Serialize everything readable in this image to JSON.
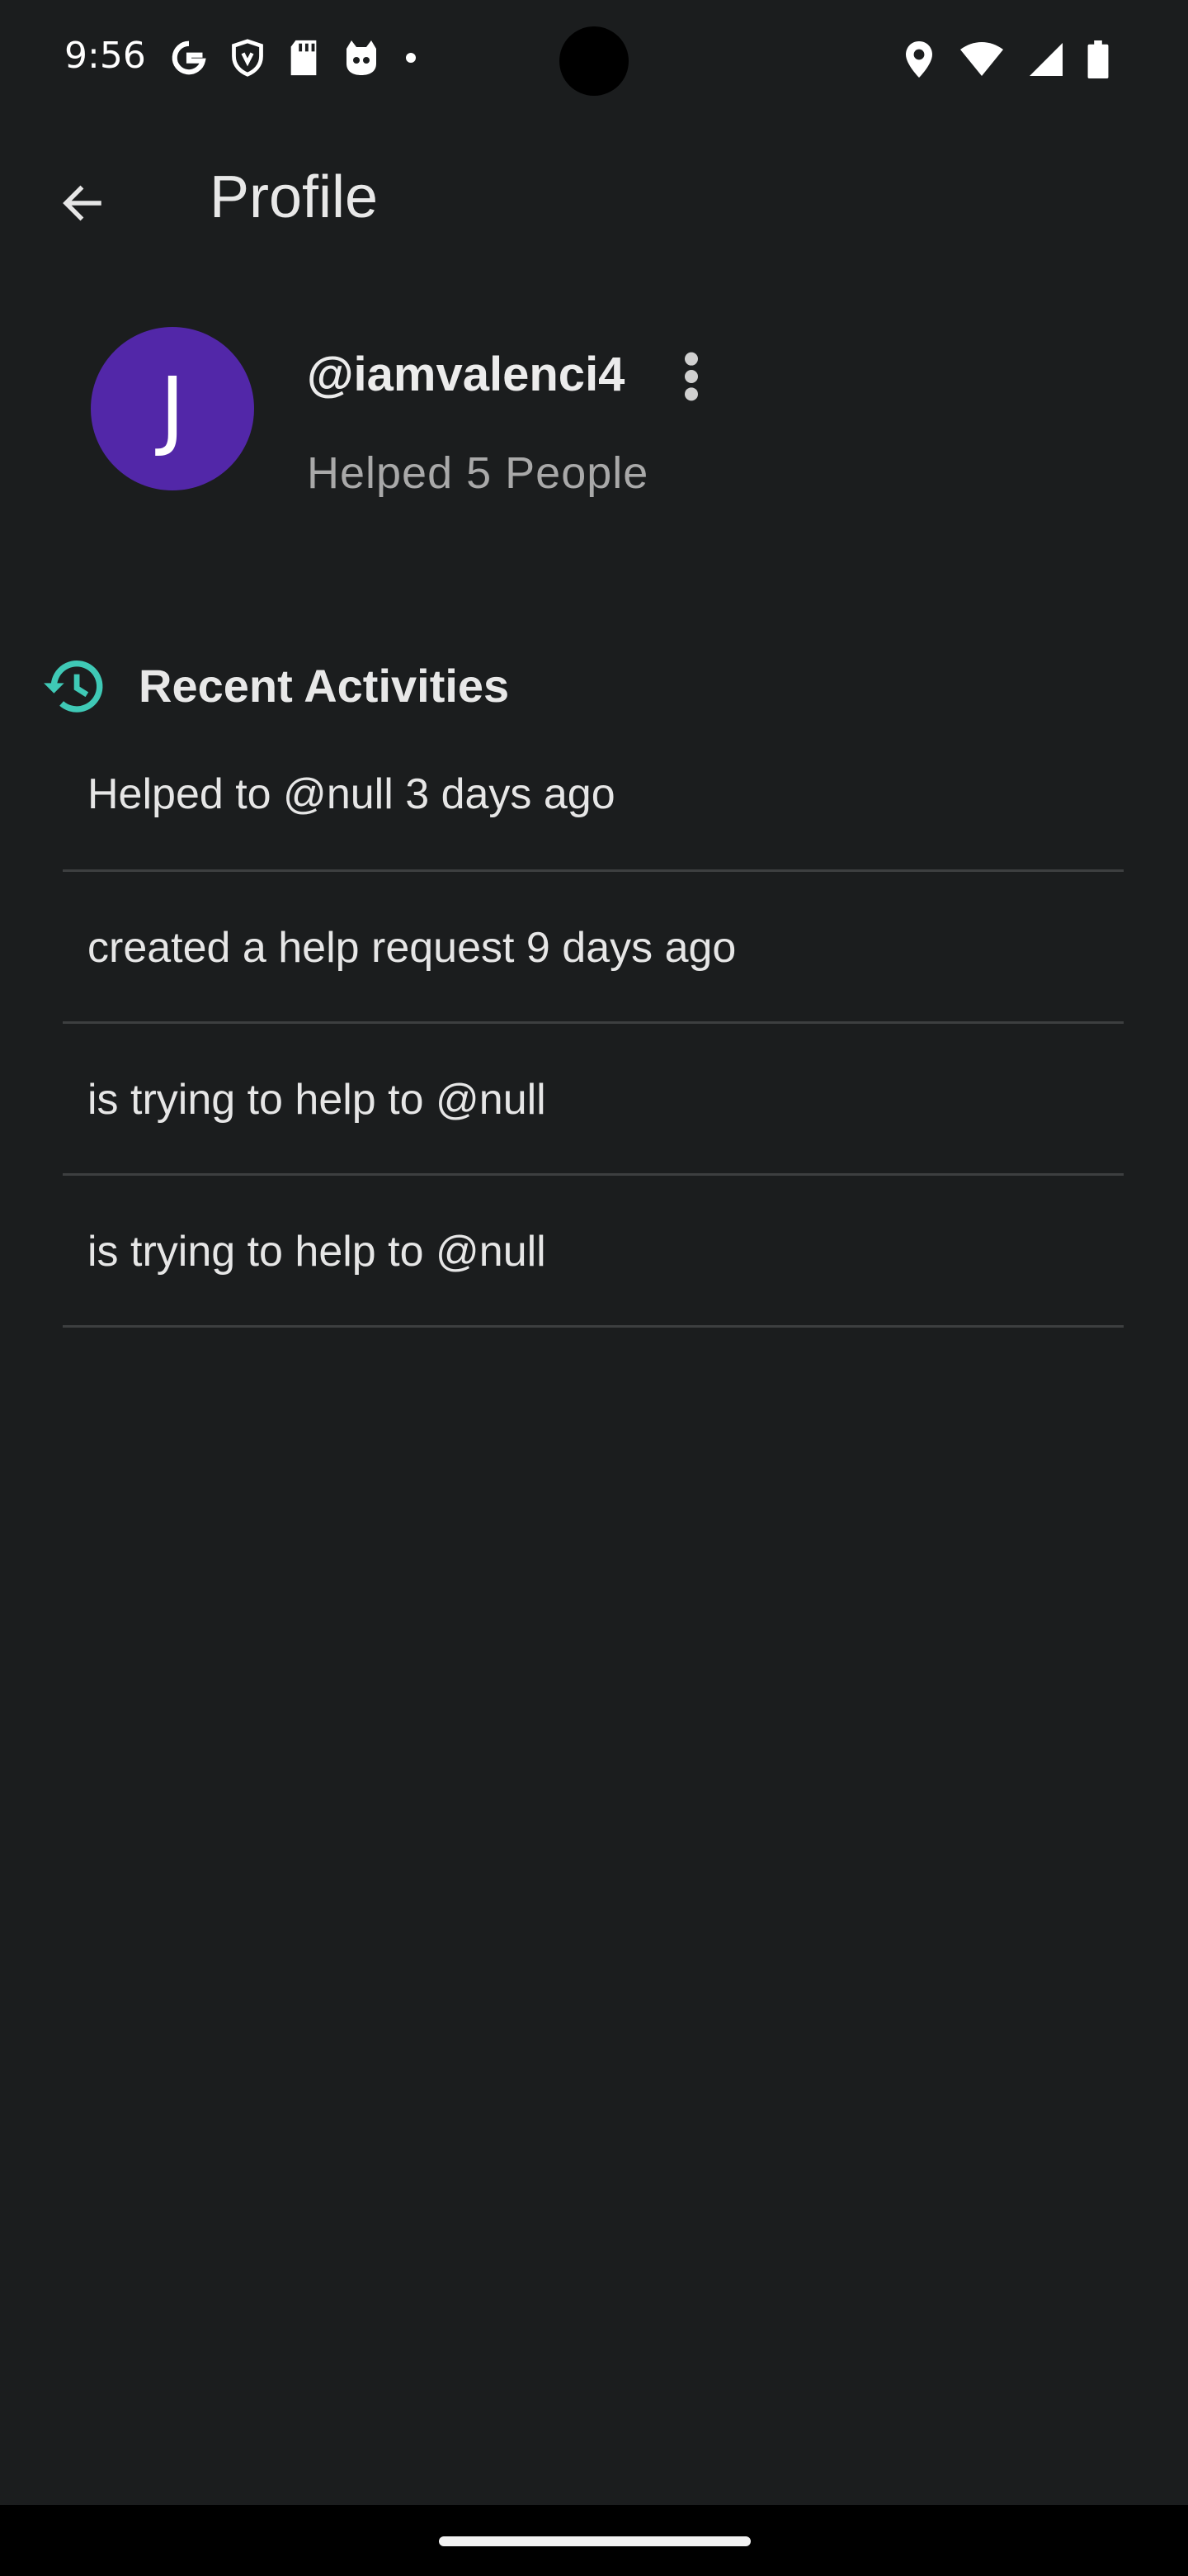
{
  "status_bar": {
    "time": "9:56",
    "left_icons": [
      "google-icon",
      "shield-icon",
      "sd-card-icon",
      "cat-face-icon",
      "dot-icon"
    ],
    "right_icons": [
      "location-icon",
      "wifi-icon",
      "signal-icon",
      "battery-icon"
    ]
  },
  "app_bar": {
    "title": "Profile",
    "back_icon": "arrow-back-icon"
  },
  "profile": {
    "avatar_letter": "J",
    "avatar_color": "#5227a8",
    "username": "@iamvalenci4",
    "helped_summary": "Helped 5 People",
    "more_icon": "more-vert-icon"
  },
  "recent_activities": {
    "title": "Recent Activities",
    "icon": "history-icon",
    "icon_color": "#3fc9b6",
    "items": [
      {
        "text": "Helped to @null 3 days ago"
      },
      {
        "text": "created a help request 9 days ago"
      },
      {
        "text": "is trying to help to @null"
      },
      {
        "text": "is trying to help to @null"
      }
    ]
  }
}
